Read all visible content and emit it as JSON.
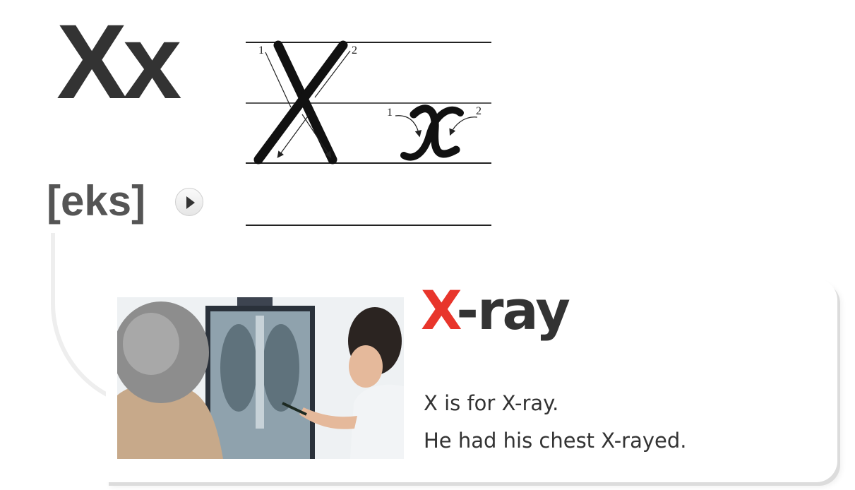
{
  "letter": {
    "display": "Xx",
    "phonetic": "[eks]",
    "stroke_numbers": [
      "1",
      "2",
      "1",
      "2"
    ],
    "play_icon": "play-icon"
  },
  "example": {
    "word_highlight": "X",
    "word_rest": "-ray",
    "sentences": [
      "X is for X-ray.",
      "He had his chest X-rayed."
    ]
  },
  "colors": {
    "text": "#333333",
    "highlight": "#e8352b"
  }
}
